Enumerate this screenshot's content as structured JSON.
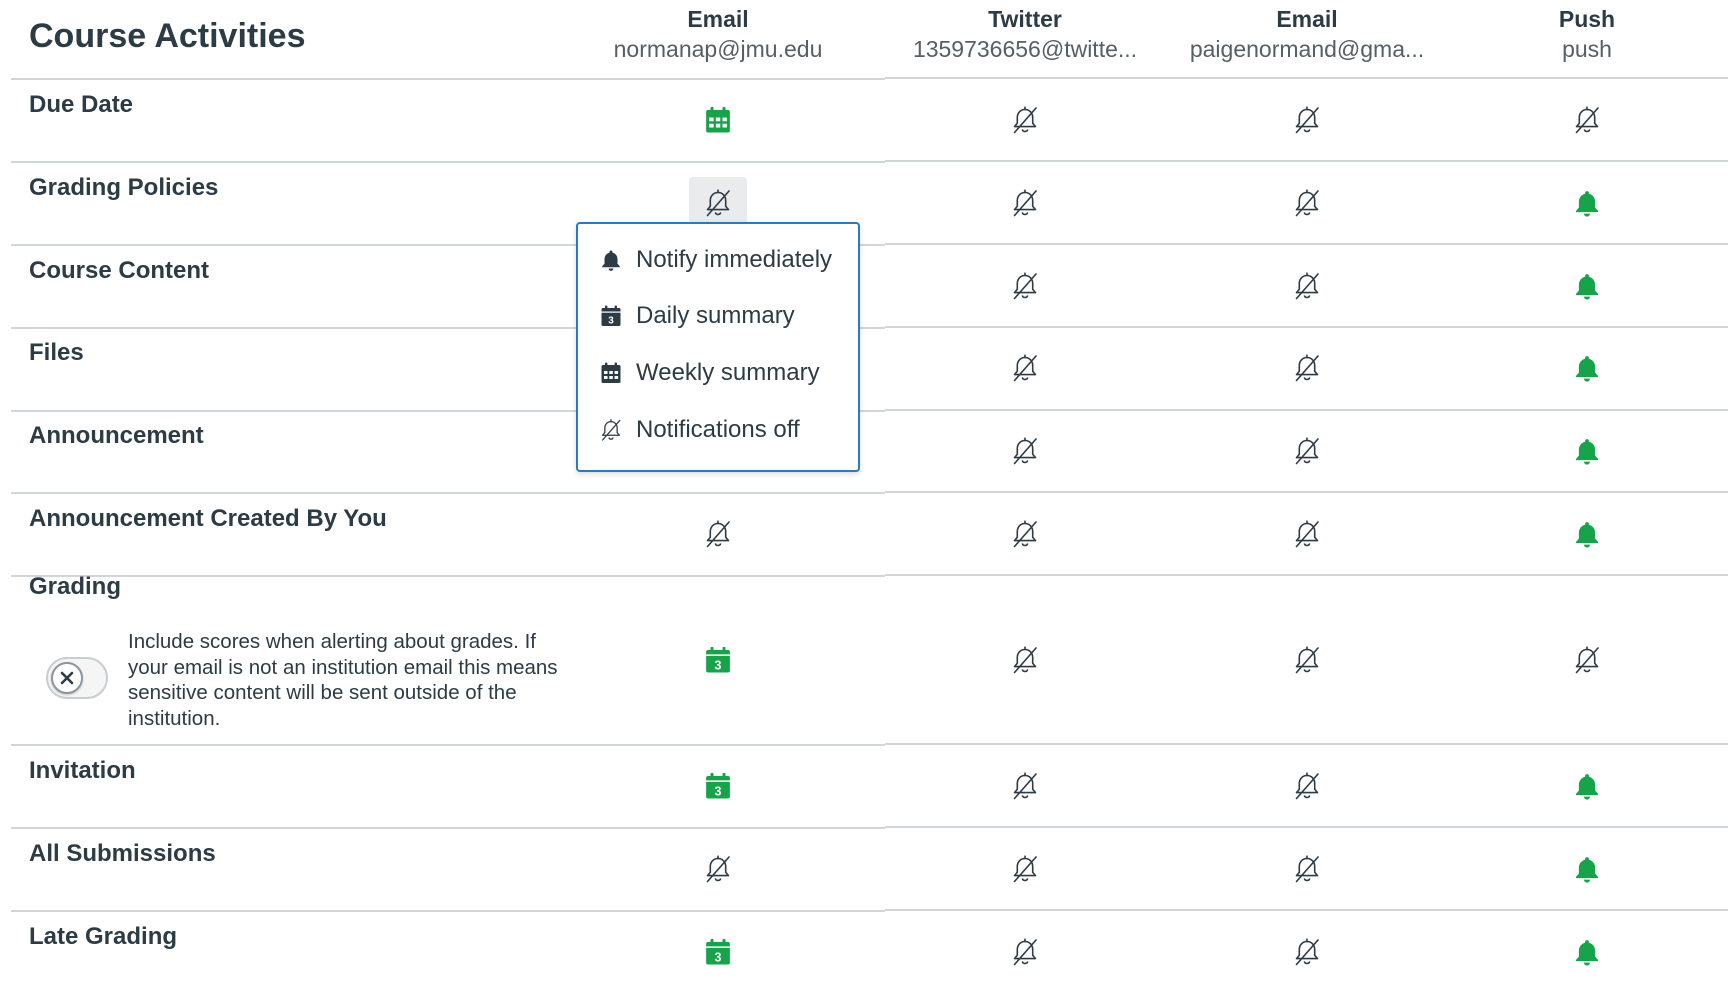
{
  "header": {
    "title": "Course Activities",
    "channels": [
      {
        "type": "Email",
        "address": "normanap@jmu.edu"
      },
      {
        "type": "Twitter",
        "address": "1359736656@twitte..."
      },
      {
        "type": "Email",
        "address": "paigenormand@gma..."
      },
      {
        "type": "Push",
        "address": "push"
      }
    ]
  },
  "colors": {
    "accent_green": "#17a34a",
    "dark_icon": "#2d3b45",
    "focus_blue": "#2b7abc"
  },
  "rows": [
    {
      "label": "Due Date",
      "settings": [
        "weekly",
        "off",
        "off",
        "off"
      ]
    },
    {
      "label": "Grading Policies",
      "settings": [
        "off",
        "off",
        "off",
        "immediately"
      ]
    },
    {
      "label": "Course Content",
      "settings": [
        "",
        "off",
        "off",
        "immediately"
      ]
    },
    {
      "label": "Files",
      "settings": [
        "",
        "off",
        "off",
        "immediately"
      ]
    },
    {
      "label": "Announcement",
      "settings": [
        "",
        "off",
        "off",
        "immediately"
      ]
    },
    {
      "label": "Announcement Created By You",
      "settings": [
        "off",
        "off",
        "off",
        "immediately"
      ]
    },
    {
      "label": "Grading",
      "settings": [
        "daily",
        "off",
        "off",
        "off"
      ],
      "description": "Include scores when alerting about grades. If your email is not an institution email this means sensitive content will be sent outside of the institution.",
      "include_scores_enabled": false
    },
    {
      "label": "Invitation",
      "settings": [
        "daily",
        "off",
        "off",
        "immediately"
      ]
    },
    {
      "label": "All Submissions",
      "settings": [
        "off",
        "off",
        "off",
        "immediately"
      ]
    },
    {
      "label": "Late Grading",
      "settings": [
        "daily",
        "off",
        "off",
        "immediately"
      ]
    }
  ],
  "menu": {
    "open_for": "Grading Policies",
    "items": [
      {
        "label": "Notify immediately",
        "icon": "bell-icon"
      },
      {
        "label": "Daily summary",
        "icon": "calendar-day-icon"
      },
      {
        "label": "Weekly summary",
        "icon": "calendar-month-icon"
      },
      {
        "label": "Notifications off",
        "icon": "bell-off-icon"
      }
    ]
  },
  "daily_icon_number": "3"
}
